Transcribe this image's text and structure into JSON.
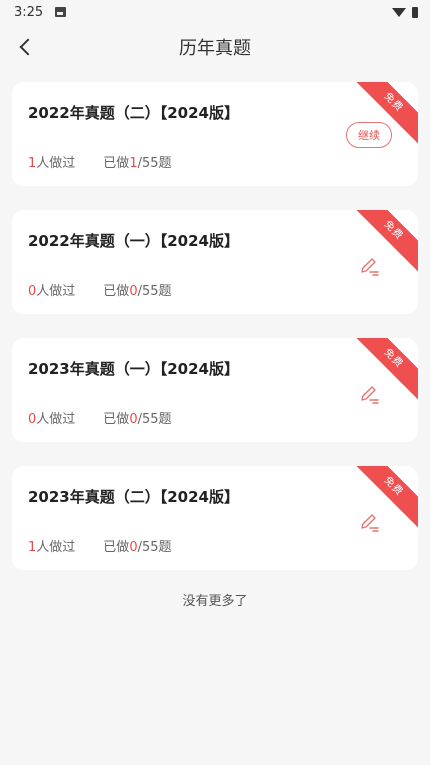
{
  "status_bar": {
    "time": "3:25"
  },
  "header": {
    "title": "历年真题"
  },
  "papers": [
    {
      "title": "2022年真题（二）【2024版】",
      "people_count": "1",
      "people_suffix": "人做过",
      "done_prefix": "已做",
      "done_count": "1",
      "done_total": "/55题",
      "badge": "免费",
      "action": "继续"
    },
    {
      "title": "2022年真题（一）【2024版】",
      "people_count": "0",
      "people_suffix": "人做过",
      "done_prefix": "已做",
      "done_count": "0",
      "done_total": "/55题",
      "badge": "免费"
    },
    {
      "title": "2023年真题（一）【2024版】",
      "people_count": "0",
      "people_suffix": "人做过",
      "done_prefix": "已做",
      "done_count": "0",
      "done_total": "/55题",
      "badge": "免费"
    },
    {
      "title": "2023年真题（二）【2024版】",
      "people_count": "1",
      "people_suffix": "人做过",
      "done_prefix": "已做",
      "done_count": "0",
      "done_total": "/55题",
      "badge": "免费"
    }
  ],
  "footer": {
    "no_more": "没有更多了"
  },
  "colors": {
    "accent": "#e54a4a",
    "ribbon": "#ef4f4f"
  }
}
